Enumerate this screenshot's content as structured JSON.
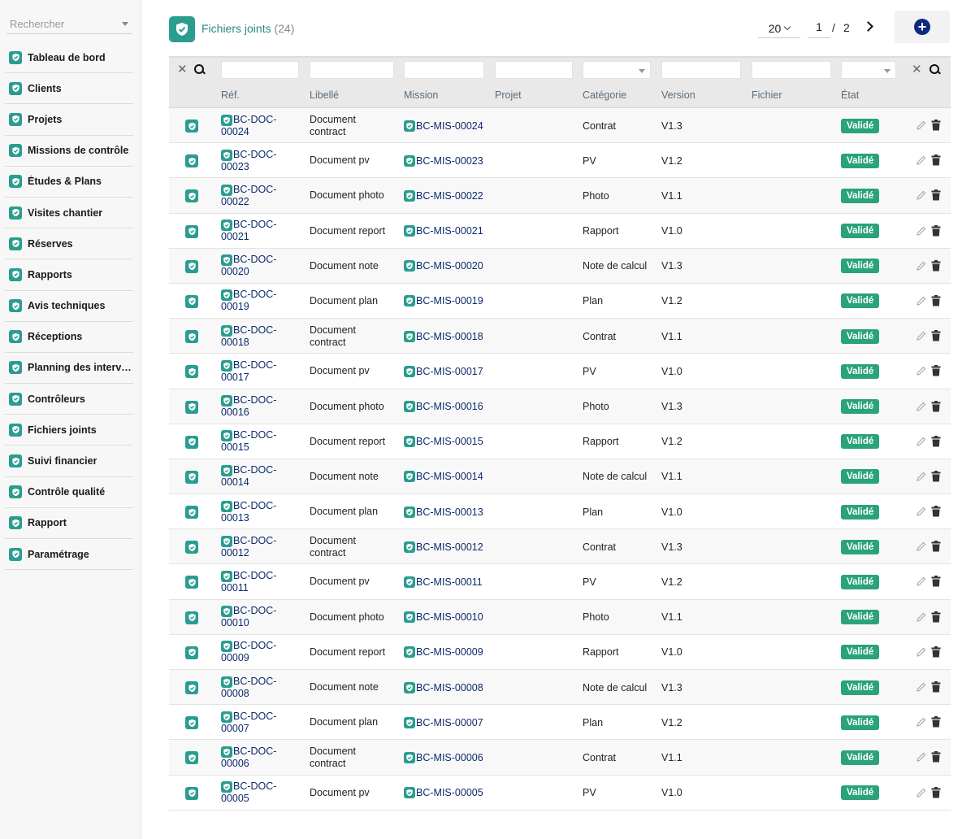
{
  "sidebar": {
    "search_placeholder": "Rechercher",
    "items": [
      {
        "label": "Tableau de bord"
      },
      {
        "label": "Clients"
      },
      {
        "label": "Projets"
      },
      {
        "label": "Missions de contrôle"
      },
      {
        "label": "Études & Plans"
      },
      {
        "label": "Visites chantier"
      },
      {
        "label": "Réserves"
      },
      {
        "label": "Rapports"
      },
      {
        "label": "Avis techniques"
      },
      {
        "label": "Réceptions"
      },
      {
        "label": "Planning des interv…"
      },
      {
        "label": "Contrôleurs"
      },
      {
        "label": "Fichiers joints"
      },
      {
        "label": "Suivi financier"
      },
      {
        "label": "Contrôle qualité"
      },
      {
        "label": "Rapport"
      },
      {
        "label": "Paramétrage"
      }
    ]
  },
  "header": {
    "title": "Fichiers joints",
    "count": "(24)",
    "page_size": "20",
    "page_current": "1",
    "page_sep": "/",
    "page_total": "2"
  },
  "table": {
    "columns": [
      "Réf.",
      "Libellé",
      "Mission",
      "Projet",
      "Catégorie",
      "Version",
      "Fichier",
      "État"
    ],
    "rows": [
      {
        "ref1": "BC-DOC-",
        "ref2": "00024",
        "libelle": "Document contract",
        "mission": "BC-MIS-00024",
        "projet": "",
        "categorie": "Contrat",
        "version": "V1.3",
        "fichier": "",
        "etat": "Validé"
      },
      {
        "ref1": "BC-DOC-",
        "ref2": "00023",
        "libelle": "Document pv",
        "mission": "BC-MIS-00023",
        "projet": "",
        "categorie": "PV",
        "version": "V1.2",
        "fichier": "",
        "etat": "Validé"
      },
      {
        "ref1": "BC-DOC-",
        "ref2": "00022",
        "libelle": "Document photo",
        "mission": "BC-MIS-00022",
        "projet": "",
        "categorie": "Photo",
        "version": "V1.1",
        "fichier": "",
        "etat": "Validé"
      },
      {
        "ref1": "BC-DOC-",
        "ref2": "00021",
        "libelle": "Document report",
        "mission": "BC-MIS-00021",
        "projet": "",
        "categorie": "Rapport",
        "version": "V1.0",
        "fichier": "",
        "etat": "Validé"
      },
      {
        "ref1": "BC-DOC-",
        "ref2": "00020",
        "libelle": "Document note",
        "mission": "BC-MIS-00020",
        "projet": "",
        "categorie": "Note de calcul",
        "version": "V1.3",
        "fichier": "",
        "etat": "Validé"
      },
      {
        "ref1": "BC-DOC-",
        "ref2": "00019",
        "libelle": "Document plan",
        "mission": "BC-MIS-00019",
        "projet": "",
        "categorie": "Plan",
        "version": "V1.2",
        "fichier": "",
        "etat": "Validé"
      },
      {
        "ref1": "BC-DOC-",
        "ref2": "00018",
        "libelle": "Document contract",
        "mission": "BC-MIS-00018",
        "projet": "",
        "categorie": "Contrat",
        "version": "V1.1",
        "fichier": "",
        "etat": "Validé"
      },
      {
        "ref1": "BC-DOC-",
        "ref2": "00017",
        "libelle": "Document pv",
        "mission": "BC-MIS-00017",
        "projet": "",
        "categorie": "PV",
        "version": "V1.0",
        "fichier": "",
        "etat": "Validé"
      },
      {
        "ref1": "BC-DOC-",
        "ref2": "00016",
        "libelle": "Document photo",
        "mission": "BC-MIS-00016",
        "projet": "",
        "categorie": "Photo",
        "version": "V1.3",
        "fichier": "",
        "etat": "Validé"
      },
      {
        "ref1": "BC-DOC-",
        "ref2": "00015",
        "libelle": "Document report",
        "mission": "BC-MIS-00015",
        "projet": "",
        "categorie": "Rapport",
        "version": "V1.2",
        "fichier": "",
        "etat": "Validé"
      },
      {
        "ref1": "BC-DOC-",
        "ref2": "00014",
        "libelle": "Document note",
        "mission": "BC-MIS-00014",
        "projet": "",
        "categorie": "Note de calcul",
        "version": "V1.1",
        "fichier": "",
        "etat": "Validé"
      },
      {
        "ref1": "BC-DOC-",
        "ref2": "00013",
        "libelle": "Document plan",
        "mission": "BC-MIS-00013",
        "projet": "",
        "categorie": "Plan",
        "version": "V1.0",
        "fichier": "",
        "etat": "Validé"
      },
      {
        "ref1": "BC-DOC-",
        "ref2": "00012",
        "libelle": "Document contract",
        "mission": "BC-MIS-00012",
        "projet": "",
        "categorie": "Contrat",
        "version": "V1.3",
        "fichier": "",
        "etat": "Validé"
      },
      {
        "ref1": "BC-DOC-",
        "ref2": "00011",
        "libelle": "Document pv",
        "mission": "BC-MIS-00011",
        "projet": "",
        "categorie": "PV",
        "version": "V1.2",
        "fichier": "",
        "etat": "Validé"
      },
      {
        "ref1": "BC-DOC-",
        "ref2": "00010",
        "libelle": "Document photo",
        "mission": "BC-MIS-00010",
        "projet": "",
        "categorie": "Photo",
        "version": "V1.1",
        "fichier": "",
        "etat": "Validé"
      },
      {
        "ref1": "BC-DOC-",
        "ref2": "00009",
        "libelle": "Document report",
        "mission": "BC-MIS-00009",
        "projet": "",
        "categorie": "Rapport",
        "version": "V1.0",
        "fichier": "",
        "etat": "Validé"
      },
      {
        "ref1": "BC-DOC-",
        "ref2": "00008",
        "libelle": "Document note",
        "mission": "BC-MIS-00008",
        "projet": "",
        "categorie": "Note de calcul",
        "version": "V1.3",
        "fichier": "",
        "etat": "Validé"
      },
      {
        "ref1": "BC-DOC-",
        "ref2": "00007",
        "libelle": "Document plan",
        "mission": "BC-MIS-00007",
        "projet": "",
        "categorie": "Plan",
        "version": "V1.2",
        "fichier": "",
        "etat": "Validé"
      },
      {
        "ref1": "BC-DOC-",
        "ref2": "00006",
        "libelle": "Document contract",
        "mission": "BC-MIS-00006",
        "projet": "",
        "categorie": "Contrat",
        "version": "V1.1",
        "fichier": "",
        "etat": "Validé"
      },
      {
        "ref1": "BC-DOC-",
        "ref2": "00005",
        "libelle": "Document pv",
        "mission": "BC-MIS-00005",
        "projet": "",
        "categorie": "PV",
        "version": "V1.0",
        "fichier": "",
        "etat": "Validé"
      }
    ]
  },
  "colors": {
    "accent": "#2a9d8f",
    "link": "#0d2a6b",
    "status_valid": "#2aa379",
    "add_button": "#0d2a80"
  },
  "icons": {
    "nav": "shield-check-icon",
    "row_select": "checkbox-icon",
    "edit": "pencil-icon",
    "delete": "trash-icon",
    "clear_filter": "close-icon",
    "search": "search-icon",
    "add": "plus-circle-icon",
    "next": "chevron-right-icon"
  }
}
